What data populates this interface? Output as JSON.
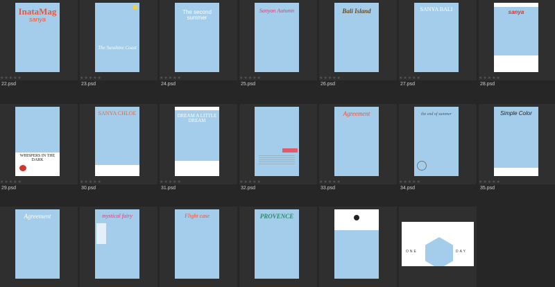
{
  "files": [
    {
      "name": "22.psd",
      "title": "InataMag",
      "subtitle": "sanya",
      "title_color": "#e8563c"
    },
    {
      "name": "23.psd",
      "title": "The Sunshine Coast",
      "subtitle": "",
      "title_color": "#ffffff"
    },
    {
      "name": "24.psd",
      "title": "The second summer",
      "subtitle": "",
      "title_color": "#ffffff"
    },
    {
      "name": "25.psd",
      "title": "Sanyan Autumn",
      "subtitle": "",
      "title_color": "#d9407a"
    },
    {
      "name": "26.psd",
      "title": "Bali Island",
      "subtitle": "",
      "title_color": "#6b4a1e"
    },
    {
      "name": "27.psd",
      "title": "SANYA BALI",
      "subtitle": "",
      "title_color": "#ffffff"
    },
    {
      "name": "28.psd",
      "title": "sanya",
      "subtitle": "",
      "title_color": "#d0352c"
    },
    {
      "name": "29.psd",
      "title": "WHISPERS IN THE DARK",
      "subtitle": "",
      "title_color": "#111111"
    },
    {
      "name": "30.psd",
      "title": "SANYA CHLOE",
      "subtitle": "",
      "title_color": "#e06a4a"
    },
    {
      "name": "31.psd",
      "title": "DREAM A LITTLE DREAM",
      "subtitle": "",
      "title_color": "#ffffff"
    },
    {
      "name": "32.psd",
      "title": "",
      "subtitle": "",
      "title_color": "#ffffff"
    },
    {
      "name": "33.psd",
      "title": "Agreement",
      "subtitle": "",
      "title_color": "#e8563c"
    },
    {
      "name": "34.psd",
      "title": "the end of summer",
      "subtitle": "",
      "title_color": "#555555"
    },
    {
      "name": "35.psd",
      "title": "Simple Color",
      "subtitle": "",
      "title_color": "#222222"
    },
    {
      "name": "",
      "title": "Agreement",
      "subtitle": "",
      "title_color": "#ffffff"
    },
    {
      "name": "",
      "title": "mystical fairy",
      "subtitle": "",
      "title_color": "#d9407a"
    },
    {
      "name": "",
      "title": "Flight case",
      "subtitle": "",
      "title_color": "#e8563c"
    },
    {
      "name": "",
      "title": "PROVENCE",
      "subtitle": "",
      "title_color": "#2e8a6a"
    },
    {
      "name": "",
      "title": "",
      "subtitle": "",
      "title_color": "#222222"
    },
    {
      "name": "",
      "title": "ONE",
      "subtitle": "DAY",
      "title_color": "#333333"
    }
  ],
  "stars": "★★★★★",
  "colors": {
    "background": "#262626",
    "tile": "#2f2f2f",
    "thumb_blue": "#a3cdea"
  }
}
